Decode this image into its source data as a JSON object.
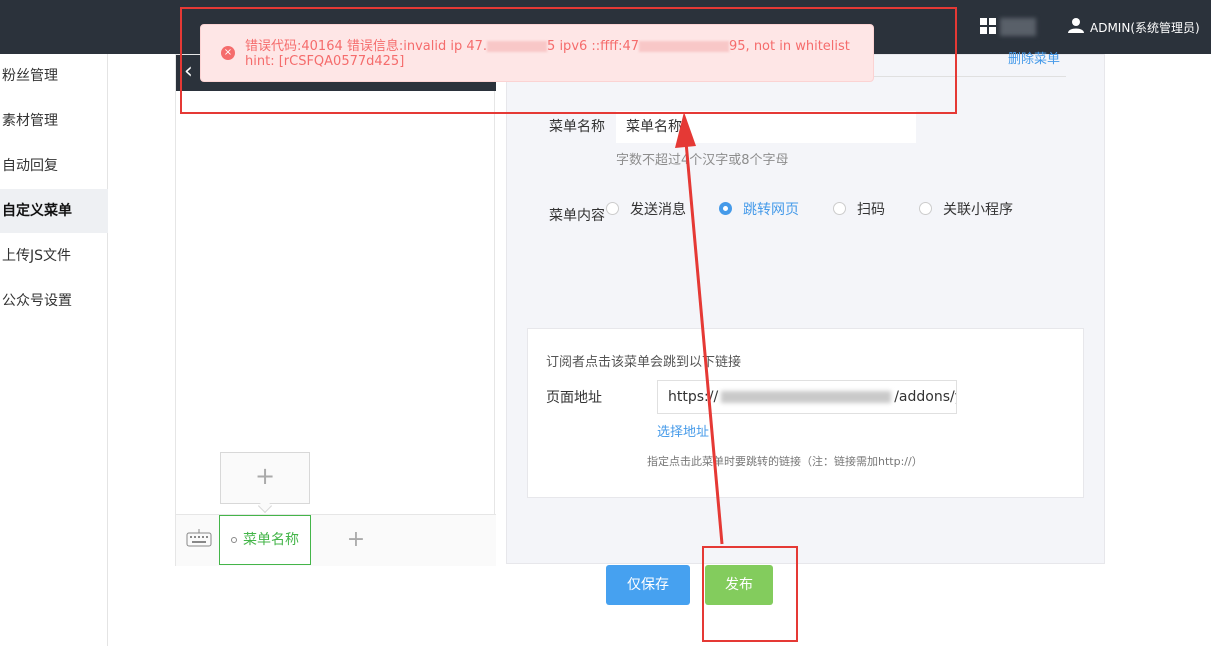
{
  "topbar": {
    "user_label": "ADMIN(系统管理员)"
  },
  "sidebar": {
    "items": [
      {
        "label": "粉丝管理"
      },
      {
        "label": "素材管理"
      },
      {
        "label": "自动回复"
      },
      {
        "label": "自定义菜单"
      },
      {
        "label": "上传JS文件"
      },
      {
        "label": "公众号设置"
      }
    ]
  },
  "phone": {
    "menu_tab_label": "菜单名称",
    "add_menu_symbol": "+",
    "add_submenu_symbol": "+"
  },
  "editor": {
    "delete_label": "删除菜单",
    "name_label": "菜单名称",
    "name_value": "菜单名称",
    "name_hint": "字数不超过4个汉字或8个字母",
    "content_label": "菜单内容",
    "options": [
      {
        "label": "发送消息",
        "selected": false
      },
      {
        "label": "跳转网页",
        "selected": true
      },
      {
        "label": "扫码",
        "selected": false
      },
      {
        "label": "关联小程序",
        "selected": false
      }
    ],
    "link_desc": "订阅者点击该菜单会跳到以下链接",
    "url_label": "页面地址",
    "url_prefix": "https://",
    "url_suffix": "/addons/yun",
    "choose_link": "选择地址",
    "link_note": "指定点击此菜单时要跳转的链接（注：链接需加http://）"
  },
  "buttons": {
    "save": "仅保存",
    "publish": "发布"
  },
  "toast": {
    "part1": "错误代码:40164 错误信息:invalid ip 47.",
    "part2": "5 ipv6 ::ffff:47",
    "part3": "95, not in whitelist hint: [rCSFQA0577d425]"
  },
  "colors": {
    "accent_blue": "#459ae9",
    "accent_green": "#44b549",
    "error_red": "#f56c6c",
    "annotation_red": "#e53935"
  }
}
